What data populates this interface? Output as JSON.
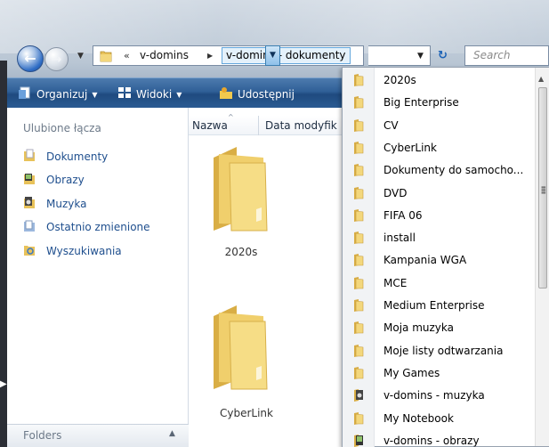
{
  "address": {
    "overflow_chevron": "«",
    "crumb_parent": "v-domins",
    "crumb_current": "v-domins - dokumenty",
    "search_placeholder": "Search"
  },
  "toolbar": {
    "organize": "Organizuj",
    "views": "Widoki",
    "share": "Udostępnij"
  },
  "nav_pane": {
    "header": "Ulubione łącza",
    "links": [
      "Dokumenty",
      "Obrazy",
      "Muzyka",
      "Ostatnio zmienione",
      "Wyszukiwania"
    ],
    "folders_label": "Folders"
  },
  "file_list": {
    "columns": [
      "Nazwa",
      "Data modyfik"
    ],
    "items": [
      "2020s",
      "CyberLink"
    ]
  },
  "dropdown": {
    "items": [
      {
        "label": "2020s",
        "icon": "folder-icon"
      },
      {
        "label": "Big Enterprise",
        "icon": "folder-icon"
      },
      {
        "label": "CV",
        "icon": "folder-icon"
      },
      {
        "label": "CyberLink",
        "icon": "folder-icon"
      },
      {
        "label": "Dokumenty do samocho...",
        "icon": "folder-icon"
      },
      {
        "label": "DVD",
        "icon": "folder-icon"
      },
      {
        "label": "FIFA 06",
        "icon": "folder-icon"
      },
      {
        "label": "install",
        "icon": "folder-icon"
      },
      {
        "label": "Kampania WGA",
        "icon": "folder-icon"
      },
      {
        "label": "MCE",
        "icon": "folder-icon"
      },
      {
        "label": "Medium Enterprise",
        "icon": "folder-icon"
      },
      {
        "label": "Moja muzyka",
        "icon": "folder-icon"
      },
      {
        "label": "Moje listy odtwarzania",
        "icon": "folder-icon"
      },
      {
        "label": "My Games",
        "icon": "folder-icon"
      },
      {
        "label": "v-domins - muzyka",
        "icon": "music-folder-icon"
      },
      {
        "label": "My Notebook",
        "icon": "folder-icon"
      },
      {
        "label": "v-domins - obrazy",
        "icon": "pictures-folder-icon"
      }
    ]
  },
  "colors": {
    "toolbar": "#2f5f97",
    "link": "#1f4f8e",
    "folder": "#e8c25a"
  }
}
